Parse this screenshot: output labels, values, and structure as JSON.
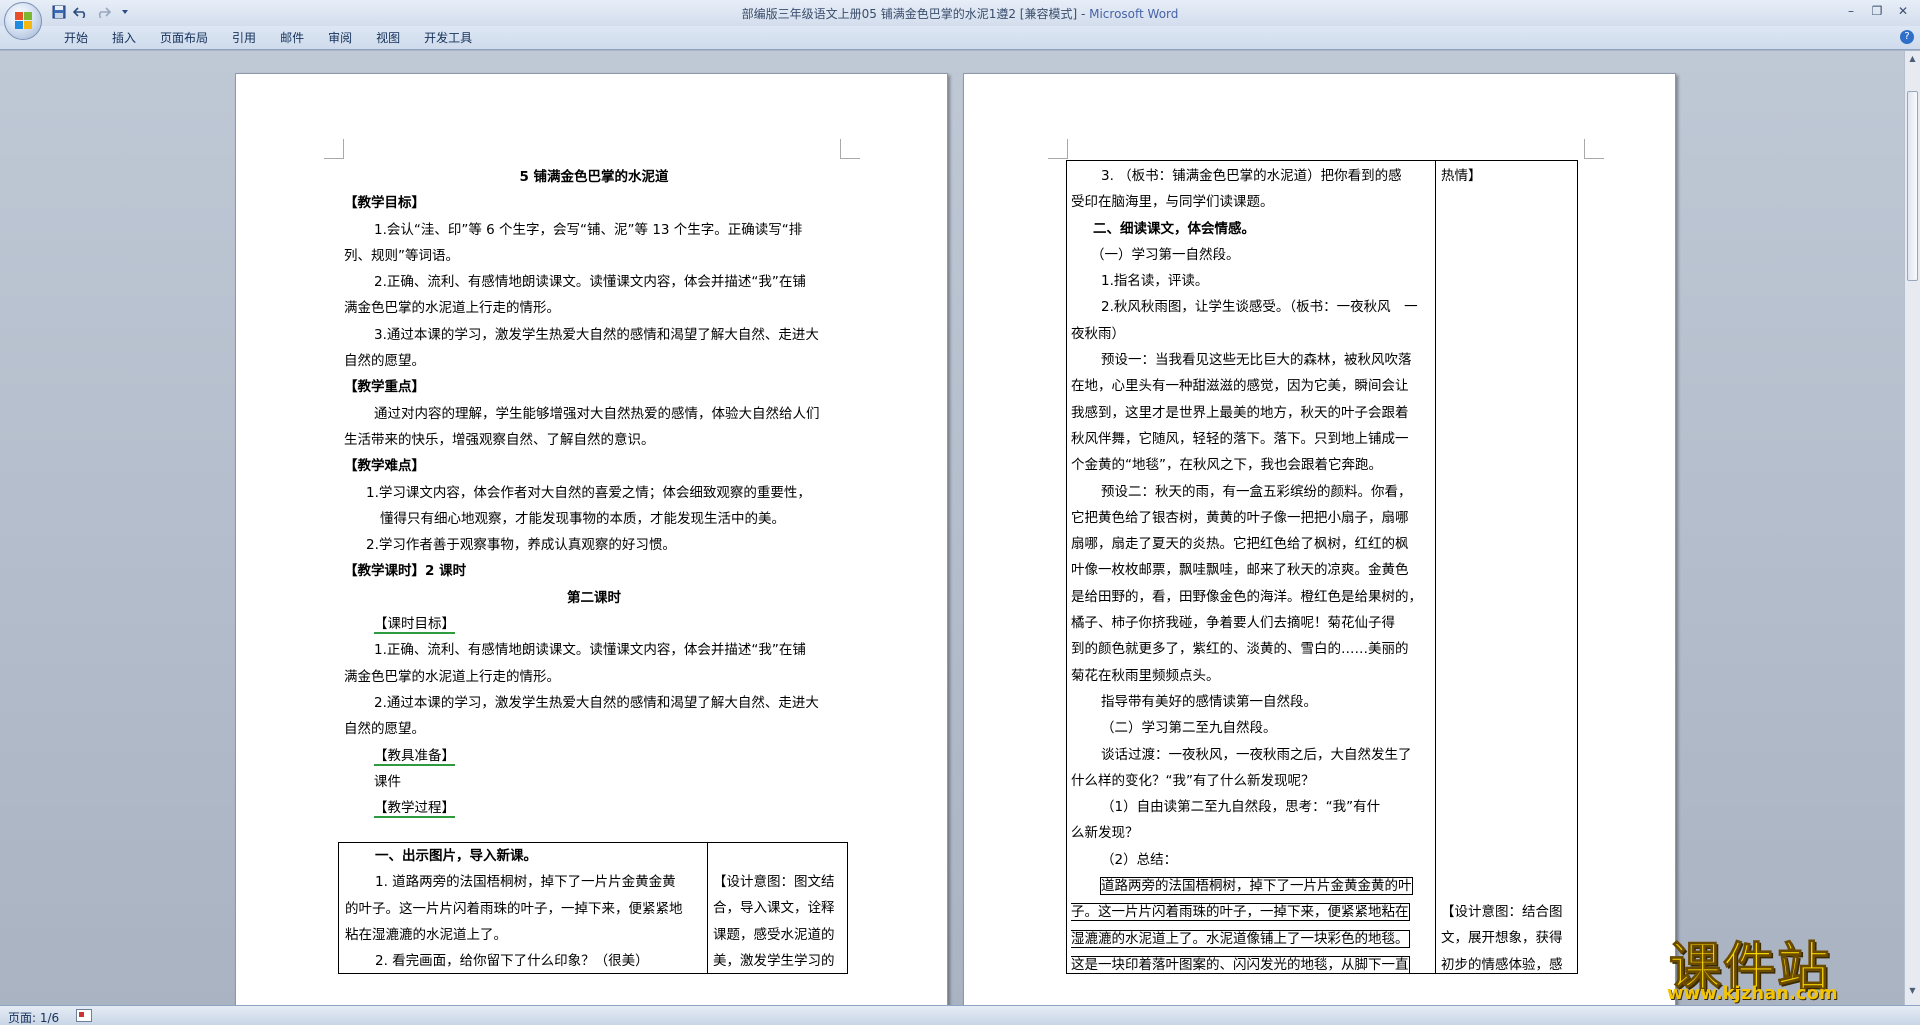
{
  "window": {
    "title": "部编版三年级语文上册05 铺满金色巴掌的水泥1遵2 [兼容模式] - ",
    "app_name": "Microsoft Word",
    "controls": [
      "–",
      "❐",
      "✕"
    ]
  },
  "quick_access": [
    "save-icon",
    "undo-icon",
    "redo-icon",
    "customize-icon"
  ],
  "ribbon_tabs": [
    "开始",
    "插入",
    "页面布局",
    "引用",
    "邮件",
    "审阅",
    "视图",
    "开发工具"
  ],
  "help_label": "?",
  "status": {
    "page": "页面: 1/6"
  },
  "watermark": {
    "text": "课件站",
    "url": "www.kjzhan.com"
  },
  "left_page": {
    "title": "5  铺满金色巴掌的水泥道",
    "lines": [
      "【教学目标】",
      "1.会认“洼、印”等 6 个生字，会写“铺、泥”等 13 个生字。正确读写“排",
      "列、规则”等词语。",
      "2.正确、流利、有感情地朗读课文。读懂课文内容，体会并描述“我”在铺",
      "满金色巴掌的水泥道上行走的情形。",
      "3.通过本课的学习，激发学生热爱大自然的感情和渴望了解大自然、走进大",
      "自然的愿望。",
      "【教学重点】",
      "通过对内容的理解，学生能够增强对大自然热爱的感情，体验大自然给人们",
      "生活带来的快乐，增强观察自然、了解自然的意识。",
      "【教学难点】",
      "1.学习课文内容，体会作者对大自然的喜爱之情；体会细致观察的重要性，",
      "懂得只有细心地观察，才能发现事物的本质，才能发现生活中的美。",
      "2.学习作者善于观察事物，养成认真观察的好习惯。",
      "【教学课时】2 课时",
      "第二课时",
      "【课时目标】",
      "1.正确、流利、有感情地朗读课文。读懂课文内容，体会并描述“我”在铺",
      "满金色巴掌的水泥道上行走的情形。",
      "2.通过本课的学习，激发学生热爱大自然的感情和渴望了解大自然、走进大",
      "自然的愿望。",
      "【教具准备】",
      "课件",
      "【教学过程】"
    ],
    "table_left": [
      "一、出示图片，导入新课。",
      "1. 道路两旁的法国梧桐树，掉下了一片片金黄金黄",
      "的叶子。这一片片闪着雨珠的叶子，一掉下来，便紧紧地",
      "粘在湿漉漉的水泥道上了。",
      "2. 看完画面，给你留下了什么印象？（很美）"
    ],
    "table_right": [
      "【设计意图：图文结",
      "合，导入课文，诠释",
      "课题，感受水泥道的",
      "美，激发学生学习的"
    ]
  },
  "right_page": {
    "col_left": [
      "3. （板书：铺满金色巴掌的水泥道）把你看到的感",
      "受印在脑海里，与同学们读课题。",
      "二、细读课文，体会情感。",
      "（一）学习第一自然段。",
      "1.指名读，评读。",
      "2.秋风秋雨图，让学生谈感受。（板书：一夜秋风　一",
      "夜秋雨）",
      "预设一：当我看见这些无比巨大的森林，被秋风吹落",
      "在地，心里头有一种甜滋滋的感觉，因为它美，瞬间会让",
      "我感到，这里才是世界上最美的地方，秋天的叶子会跟着",
      "秋风伴舞，它随风，轻轻的落下。落下。只到地上铺成一",
      "个金黄的“地毯”，在秋风之下，我也会跟着它奔跑。",
      "预设二：秋天的雨，有一盒五彩缤纷的颜料。你看，",
      "它把黄色给了银杏树，黄黄的叶子像一把把小扇子，扇哪",
      "扇哪，扇走了夏天的炎热。它把红色给了枫树，红红的枫",
      "叶像一枚枚邮票，飘哇飘哇，邮来了秋天的凉爽。金黄色",
      "是给田野的，看，田野像金色的海洋。橙红色是给果树的，",
      "橘子、柿子你挤我碰，争着要人们去摘呢！菊花仙子得",
      "到的颜色就更多了，紫红的、淡黄的、雪白的……美丽的",
      "菊花在秋雨里频频点头。",
      "指导带有美好的感情读第一自然段。",
      "（二）学习第二至九自然段。",
      "谈话过渡：一夜秋风，一夜秋雨之后，大自然发生了",
      "什么样的变化？“我”有了什么新发现呢？",
      "（1）自由读第二至九自然段，思考：“我”有什",
      "么新发现？",
      "（2）总结：",
      "道路两旁的法国梧桐树，掉下了一片片金黄金黄的叶",
      "子。这一片片闪着雨珠的叶子，一掉下来，便紧紧地粘在",
      "湿漉漉的水泥道上了。水泥道像铺上了一块彩色的地毯。",
      "这是一块印着落叶图案的、闪闪发光的地毯，从脚下一直"
    ],
    "col_right": [
      "热情】",
      "【设计意图：结合图",
      "文，展开想象，获得",
      "初步的情感体验，感"
    ]
  }
}
